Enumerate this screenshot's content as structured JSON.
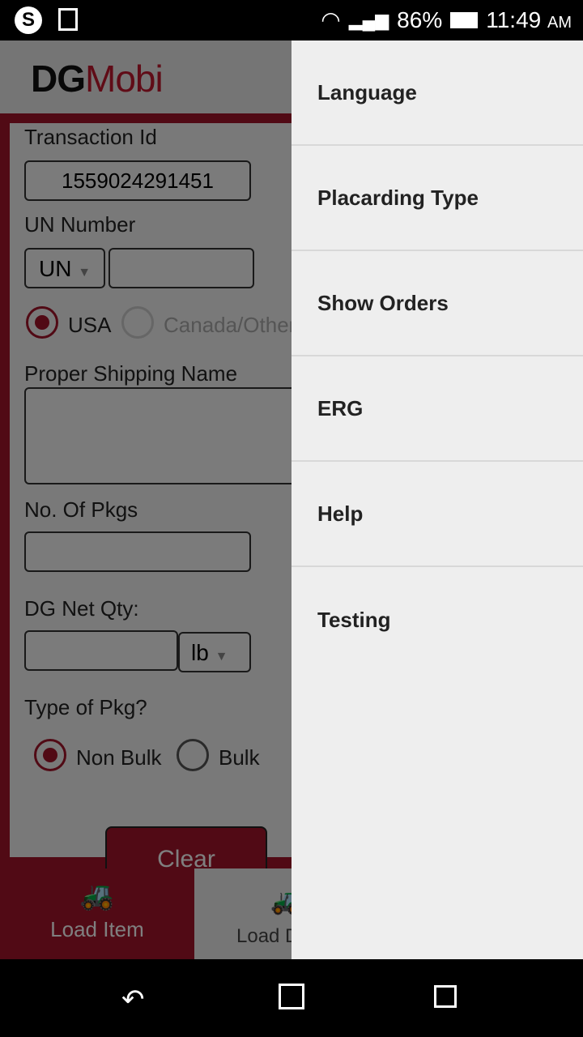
{
  "status": {
    "battery": "86%",
    "time": "11:49",
    "ampm": "AM"
  },
  "app": {
    "logo": {
      "dg": "DG",
      "mobi": "Mobi"
    },
    "form": {
      "transaction_label": "Transaction Id",
      "transaction_value": "1559024291451",
      "un_label": "UN Number",
      "un_prefix": "UN",
      "un_value": "",
      "region_options": [
        "USA",
        "Canada/Other"
      ],
      "region_selected": "USA",
      "psn_label": "Proper Shipping Name",
      "psn_value": "",
      "pkgs_label": "No. Of Pkgs",
      "pkgs_value": "",
      "netqty_label": "DG Net Qty:",
      "netqty_value": "",
      "unit": "lb",
      "pkgtype_label": "Type of Pkg?",
      "pkgtype_options": [
        "Non Bulk",
        "Bulk"
      ],
      "pkgtype_selected": "Non Bulk",
      "clear_label": "Clear"
    },
    "tabs": [
      {
        "label": "Load Item",
        "active": true
      },
      {
        "label": "Load Details",
        "active": false
      }
    ],
    "accent": "#a3152a"
  },
  "drawer": {
    "items": [
      "Language",
      "Placarding Type",
      "Show Orders",
      "ERG",
      "Help",
      "Testing"
    ]
  }
}
